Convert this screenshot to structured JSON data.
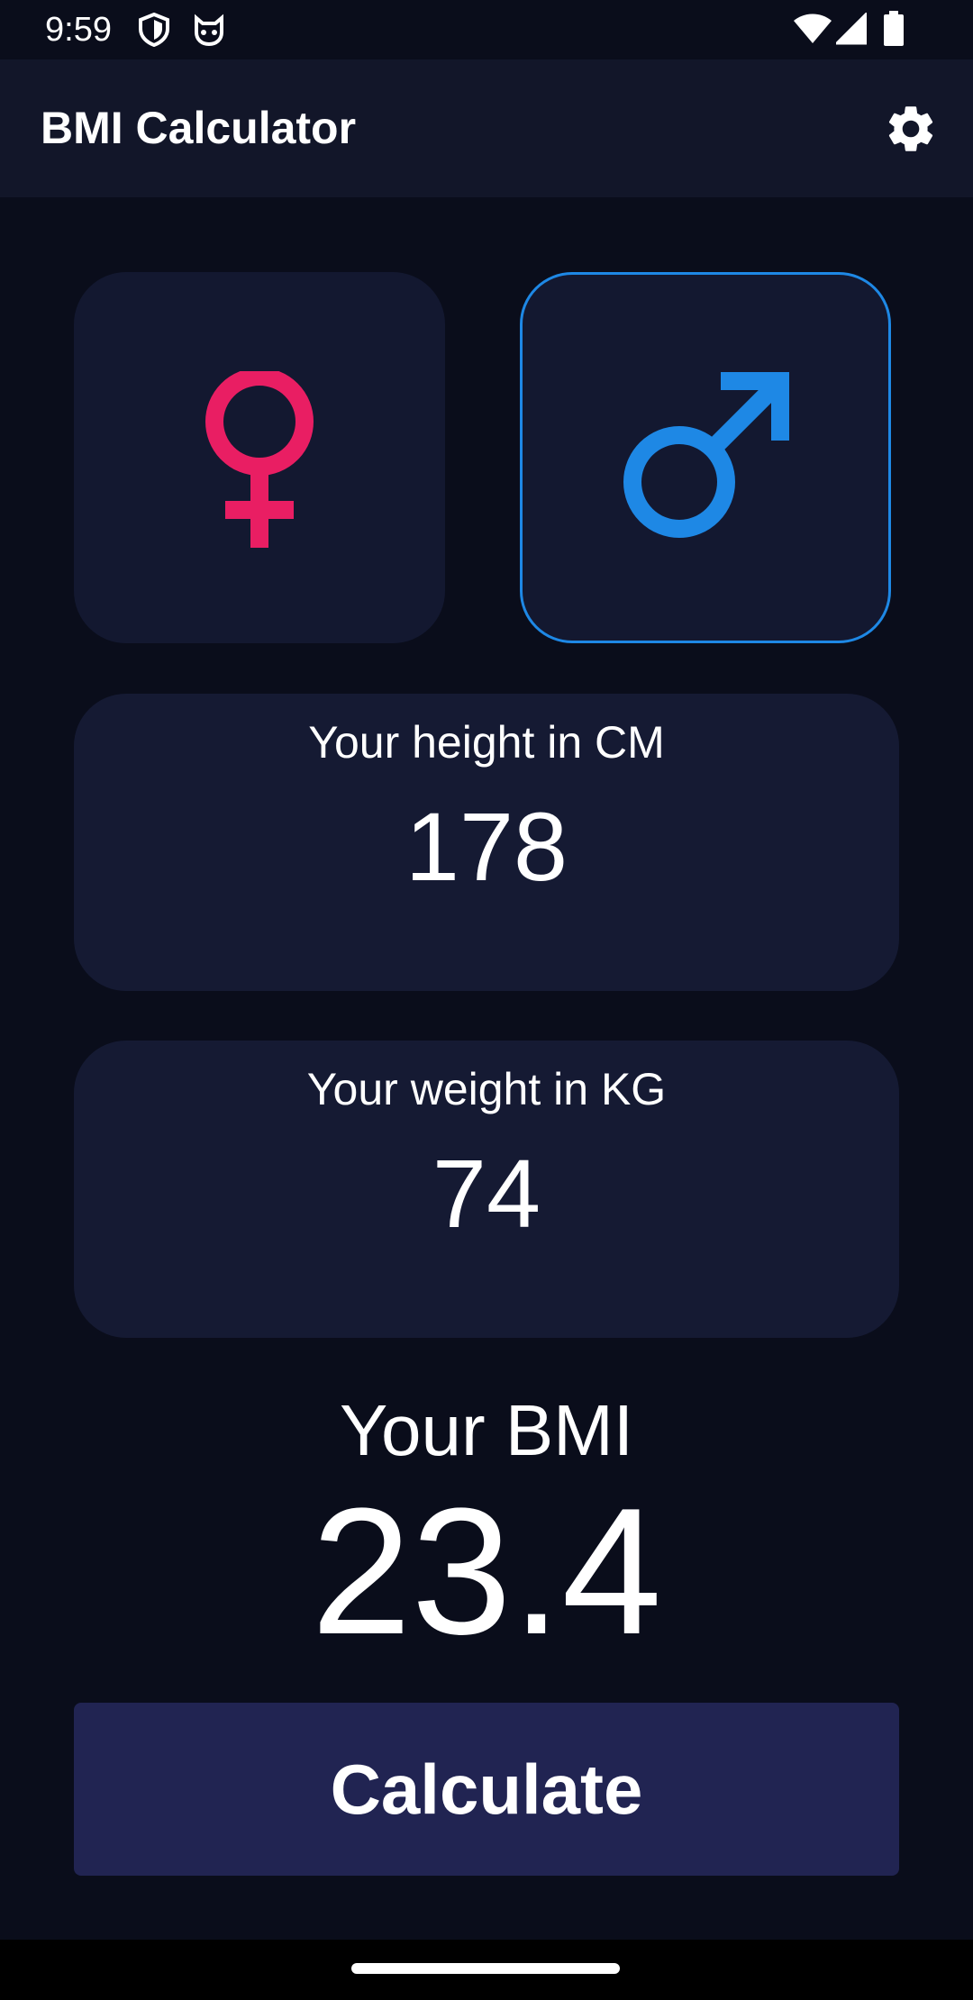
{
  "status_bar": {
    "time": "9:59",
    "left_icons": [
      "shield-icon",
      "cat-icon"
    ],
    "right_icons": [
      "wifi-icon",
      "signal-icon",
      "battery-icon"
    ]
  },
  "app_bar": {
    "title": "BMI Calculator",
    "action_icon": "gear-icon"
  },
  "gender": {
    "options": [
      {
        "name": "female",
        "icon": "female-symbol-icon",
        "color": "#e91e63",
        "selected": false
      },
      {
        "name": "male",
        "icon": "male-symbol-icon",
        "color": "#1e88e5",
        "selected": true
      }
    ]
  },
  "height": {
    "label": "Your height in CM",
    "value": "178"
  },
  "weight": {
    "label": "Your weight in KG",
    "value": "74"
  },
  "result": {
    "label": "Your BMI",
    "value": "23.4"
  },
  "calculate_button": {
    "label": "Calculate"
  },
  "colors": {
    "background": "#0a0d1b",
    "card": "#151a33",
    "button": "#212452",
    "accent_female": "#e91e63",
    "accent_male": "#1e88e5"
  }
}
